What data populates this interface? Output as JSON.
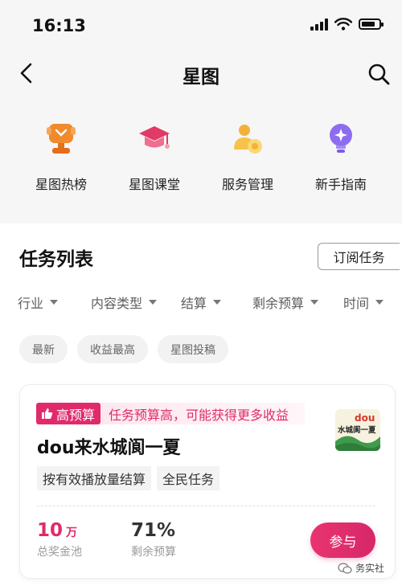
{
  "status_bar": {
    "time": "16:13"
  },
  "nav": {
    "title": "星图"
  },
  "quick_links": [
    {
      "label": "星图热榜",
      "icon": "trophy-icon"
    },
    {
      "label": "星图课堂",
      "icon": "graduation-cap-icon"
    },
    {
      "label": "服务管理",
      "icon": "service-people-icon"
    },
    {
      "label": "新手指南",
      "icon": "lightbulb-icon"
    }
  ],
  "tasks_section": {
    "title": "任务列表",
    "subscribe_label": "订阅任务",
    "filters": [
      "行业",
      "内容类型",
      "结算",
      "剩余预算",
      "时间"
    ],
    "sort_chips": [
      "最新",
      "收益最高",
      "星图投稿"
    ]
  },
  "task_card": {
    "badge": "高预算",
    "badge_desc": "任务预算高，可能获得更多收益",
    "title": "dou来水城阆一夏",
    "image_text": "dou",
    "image_subtext": "水城阆一夏",
    "tags": [
      "按有效播放量结算",
      "全民任务"
    ],
    "prize_value": "10",
    "prize_unit": "万",
    "prize_label": "总奖金池",
    "budget_value": "71%",
    "budget_label": "剩余预算",
    "join_label": "参与"
  },
  "watermark": {
    "text": "务实社"
  },
  "colors": {
    "accent": "#e02a6c",
    "header_bg": "#f6f6f6"
  }
}
